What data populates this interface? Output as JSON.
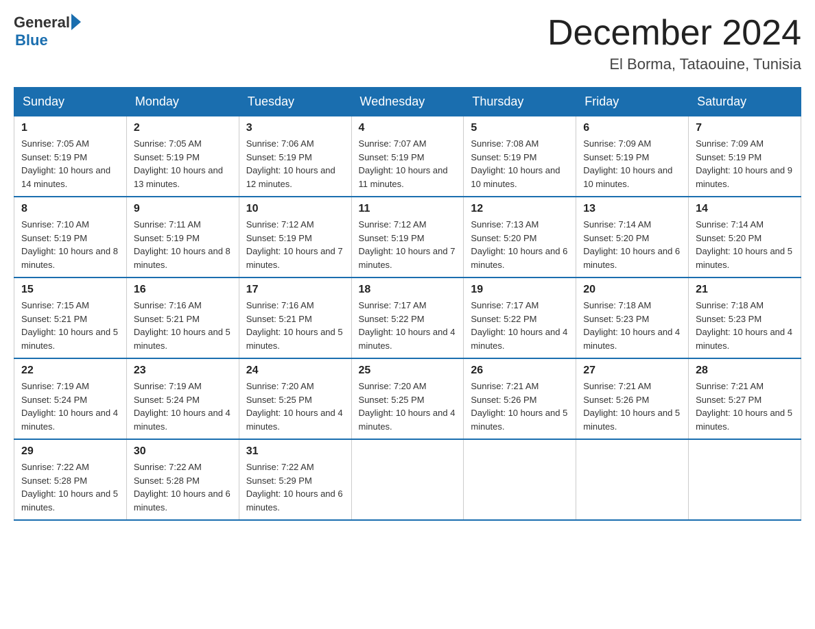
{
  "header": {
    "logo": {
      "general_text": "General",
      "blue_text": "Blue"
    },
    "title": "December 2024",
    "location": "El Borma, Tataouine, Tunisia"
  },
  "weekdays": [
    "Sunday",
    "Monday",
    "Tuesday",
    "Wednesday",
    "Thursday",
    "Friday",
    "Saturday"
  ],
  "weeks": [
    [
      {
        "day": "1",
        "sunrise": "7:05 AM",
        "sunset": "5:19 PM",
        "daylight": "10 hours and 14 minutes."
      },
      {
        "day": "2",
        "sunrise": "7:05 AM",
        "sunset": "5:19 PM",
        "daylight": "10 hours and 13 minutes."
      },
      {
        "day": "3",
        "sunrise": "7:06 AM",
        "sunset": "5:19 PM",
        "daylight": "10 hours and 12 minutes."
      },
      {
        "day": "4",
        "sunrise": "7:07 AM",
        "sunset": "5:19 PM",
        "daylight": "10 hours and 11 minutes."
      },
      {
        "day": "5",
        "sunrise": "7:08 AM",
        "sunset": "5:19 PM",
        "daylight": "10 hours and 10 minutes."
      },
      {
        "day": "6",
        "sunrise": "7:09 AM",
        "sunset": "5:19 PM",
        "daylight": "10 hours and 10 minutes."
      },
      {
        "day": "7",
        "sunrise": "7:09 AM",
        "sunset": "5:19 PM",
        "daylight": "10 hours and 9 minutes."
      }
    ],
    [
      {
        "day": "8",
        "sunrise": "7:10 AM",
        "sunset": "5:19 PM",
        "daylight": "10 hours and 8 minutes."
      },
      {
        "day": "9",
        "sunrise": "7:11 AM",
        "sunset": "5:19 PM",
        "daylight": "10 hours and 8 minutes."
      },
      {
        "day": "10",
        "sunrise": "7:12 AM",
        "sunset": "5:19 PM",
        "daylight": "10 hours and 7 minutes."
      },
      {
        "day": "11",
        "sunrise": "7:12 AM",
        "sunset": "5:19 PM",
        "daylight": "10 hours and 7 minutes."
      },
      {
        "day": "12",
        "sunrise": "7:13 AM",
        "sunset": "5:20 PM",
        "daylight": "10 hours and 6 minutes."
      },
      {
        "day": "13",
        "sunrise": "7:14 AM",
        "sunset": "5:20 PM",
        "daylight": "10 hours and 6 minutes."
      },
      {
        "day": "14",
        "sunrise": "7:14 AM",
        "sunset": "5:20 PM",
        "daylight": "10 hours and 5 minutes."
      }
    ],
    [
      {
        "day": "15",
        "sunrise": "7:15 AM",
        "sunset": "5:21 PM",
        "daylight": "10 hours and 5 minutes."
      },
      {
        "day": "16",
        "sunrise": "7:16 AM",
        "sunset": "5:21 PM",
        "daylight": "10 hours and 5 minutes."
      },
      {
        "day": "17",
        "sunrise": "7:16 AM",
        "sunset": "5:21 PM",
        "daylight": "10 hours and 5 minutes."
      },
      {
        "day": "18",
        "sunrise": "7:17 AM",
        "sunset": "5:22 PM",
        "daylight": "10 hours and 4 minutes."
      },
      {
        "day": "19",
        "sunrise": "7:17 AM",
        "sunset": "5:22 PM",
        "daylight": "10 hours and 4 minutes."
      },
      {
        "day": "20",
        "sunrise": "7:18 AM",
        "sunset": "5:23 PM",
        "daylight": "10 hours and 4 minutes."
      },
      {
        "day": "21",
        "sunrise": "7:18 AM",
        "sunset": "5:23 PM",
        "daylight": "10 hours and 4 minutes."
      }
    ],
    [
      {
        "day": "22",
        "sunrise": "7:19 AM",
        "sunset": "5:24 PM",
        "daylight": "10 hours and 4 minutes."
      },
      {
        "day": "23",
        "sunrise": "7:19 AM",
        "sunset": "5:24 PM",
        "daylight": "10 hours and 4 minutes."
      },
      {
        "day": "24",
        "sunrise": "7:20 AM",
        "sunset": "5:25 PM",
        "daylight": "10 hours and 4 minutes."
      },
      {
        "day": "25",
        "sunrise": "7:20 AM",
        "sunset": "5:25 PM",
        "daylight": "10 hours and 4 minutes."
      },
      {
        "day": "26",
        "sunrise": "7:21 AM",
        "sunset": "5:26 PM",
        "daylight": "10 hours and 5 minutes."
      },
      {
        "day": "27",
        "sunrise": "7:21 AM",
        "sunset": "5:26 PM",
        "daylight": "10 hours and 5 minutes."
      },
      {
        "day": "28",
        "sunrise": "7:21 AM",
        "sunset": "5:27 PM",
        "daylight": "10 hours and 5 minutes."
      }
    ],
    [
      {
        "day": "29",
        "sunrise": "7:22 AM",
        "sunset": "5:28 PM",
        "daylight": "10 hours and 5 minutes."
      },
      {
        "day": "30",
        "sunrise": "7:22 AM",
        "sunset": "5:28 PM",
        "daylight": "10 hours and 6 minutes."
      },
      {
        "day": "31",
        "sunrise": "7:22 AM",
        "sunset": "5:29 PM",
        "daylight": "10 hours and 6 minutes."
      },
      null,
      null,
      null,
      null
    ]
  ]
}
